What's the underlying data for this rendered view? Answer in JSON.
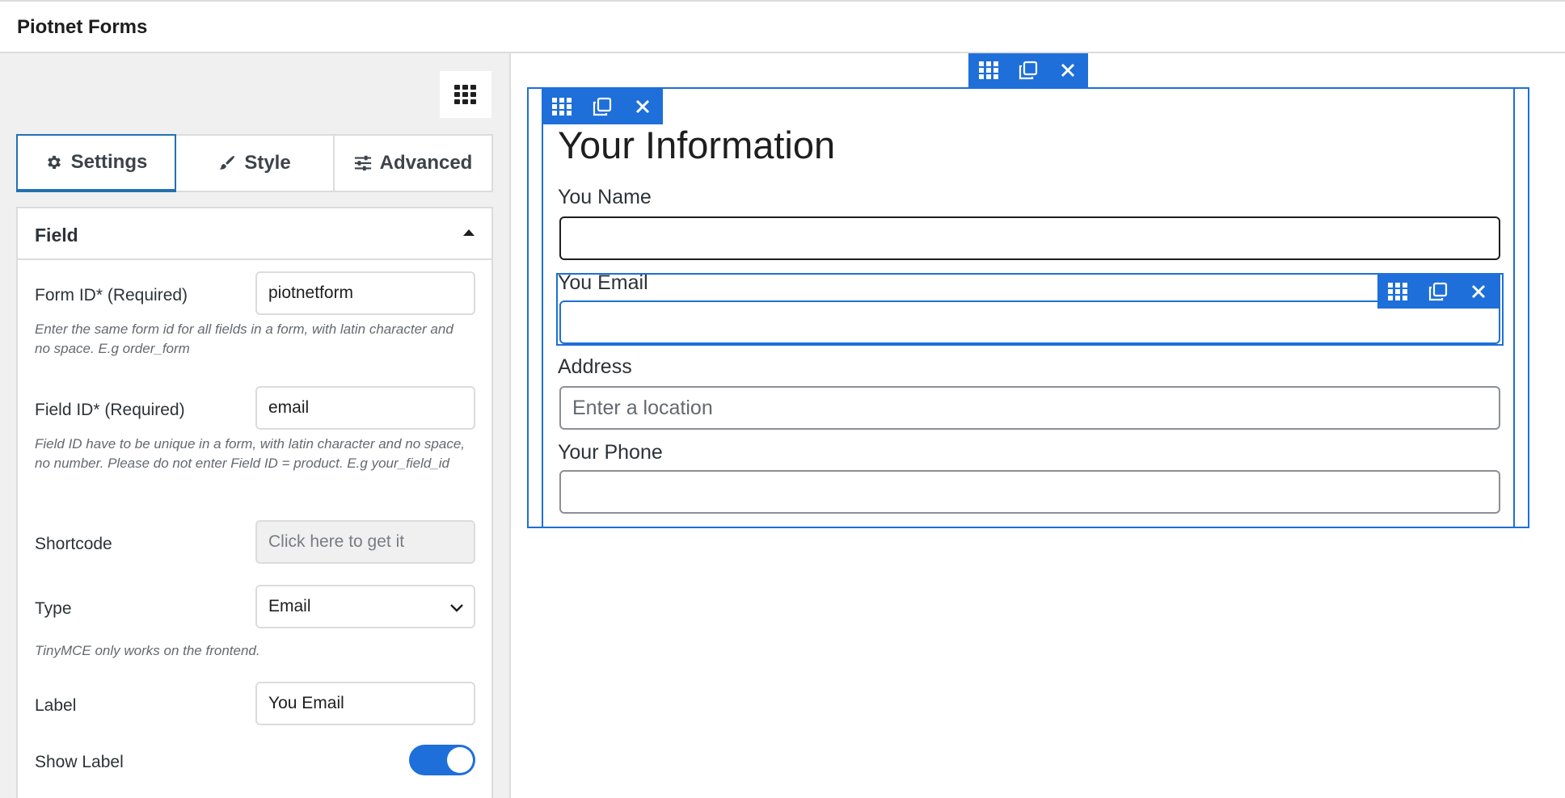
{
  "app": {
    "title": "Piotnet Forms"
  },
  "sidebar": {
    "tabs": [
      {
        "label": "Settings",
        "icon": "gear-icon",
        "active": true
      },
      {
        "label": "Style",
        "icon": "brush-icon",
        "active": false
      },
      {
        "label": "Advanced",
        "icon": "sliders-icon",
        "active": false
      }
    ],
    "section": {
      "title": "Field",
      "form_id": {
        "label": "Form ID* (Required)",
        "value": "piotnetform",
        "desc": "Enter the same form id for all fields in a form, with latin character and no space. E.g order_form"
      },
      "field_id": {
        "label": "Field ID* (Required)",
        "value": "email",
        "desc": "Field ID have to be unique in a form, with latin character and no space, no number. Please do not enter Field ID = product. E.g your_field_id"
      },
      "shortcode": {
        "label": "Shortcode",
        "value": "Click here to get it"
      },
      "type": {
        "label": "Type",
        "value": "Email",
        "desc": "TinyMCE only works on the frontend."
      },
      "field_label": {
        "label": "Label",
        "value": "You Email"
      },
      "show_label": {
        "label": "Show Label",
        "on": true
      }
    }
  },
  "canvas": {
    "heading": "Your Information",
    "fields": [
      {
        "label": "You Name",
        "placeholder": ""
      },
      {
        "label": "You Email",
        "placeholder": ""
      },
      {
        "label": "Address",
        "placeholder": "Enter a location"
      },
      {
        "label": "Your Phone",
        "placeholder": ""
      }
    ]
  },
  "colors": {
    "accent": "#1e6fd9",
    "toolbar_icon": "#ffffff"
  }
}
